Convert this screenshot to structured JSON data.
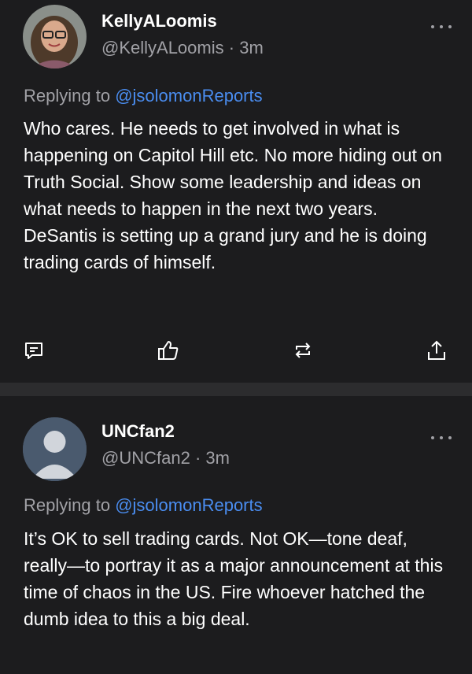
{
  "posts": [
    {
      "display_name": "KellyALoomis",
      "handle": "@KellyALoomis",
      "separator": "·",
      "time": "3m",
      "replying_prefix": "Replying to",
      "replying_to": "@jsolomonReports",
      "text": "Who cares. He needs to get involved in what is happening on Capitol Hill etc. No more hiding out on Truth Social. Show some leadership and ideas on what needs to happen in the next two years. DeSantis is setting up a grand jury and he is doing trading cards of himself.",
      "avatar": "user-photo",
      "actions": [
        "comment-icon",
        "thumbs-up-icon",
        "repost-icon",
        "share-icon"
      ]
    },
    {
      "display_name": "UNCfan2",
      "handle": "@UNCfan2",
      "separator": "·",
      "time": "3m",
      "replying_prefix": "Replying to",
      "replying_to": "@jsolomonReports",
      "text": "It’s OK to sell trading cards. Not OK—tone deaf, really—to portray it as a major announcement at this time of chaos in the US. Fire whoever hatched the dumb idea to this a big deal.",
      "avatar": "default-avatar"
    }
  ],
  "colors": {
    "background": "#1c1c1e",
    "separator": "#2c2c2e",
    "secondary_text": "#a1a1a6",
    "mention": "#4a8df0"
  }
}
